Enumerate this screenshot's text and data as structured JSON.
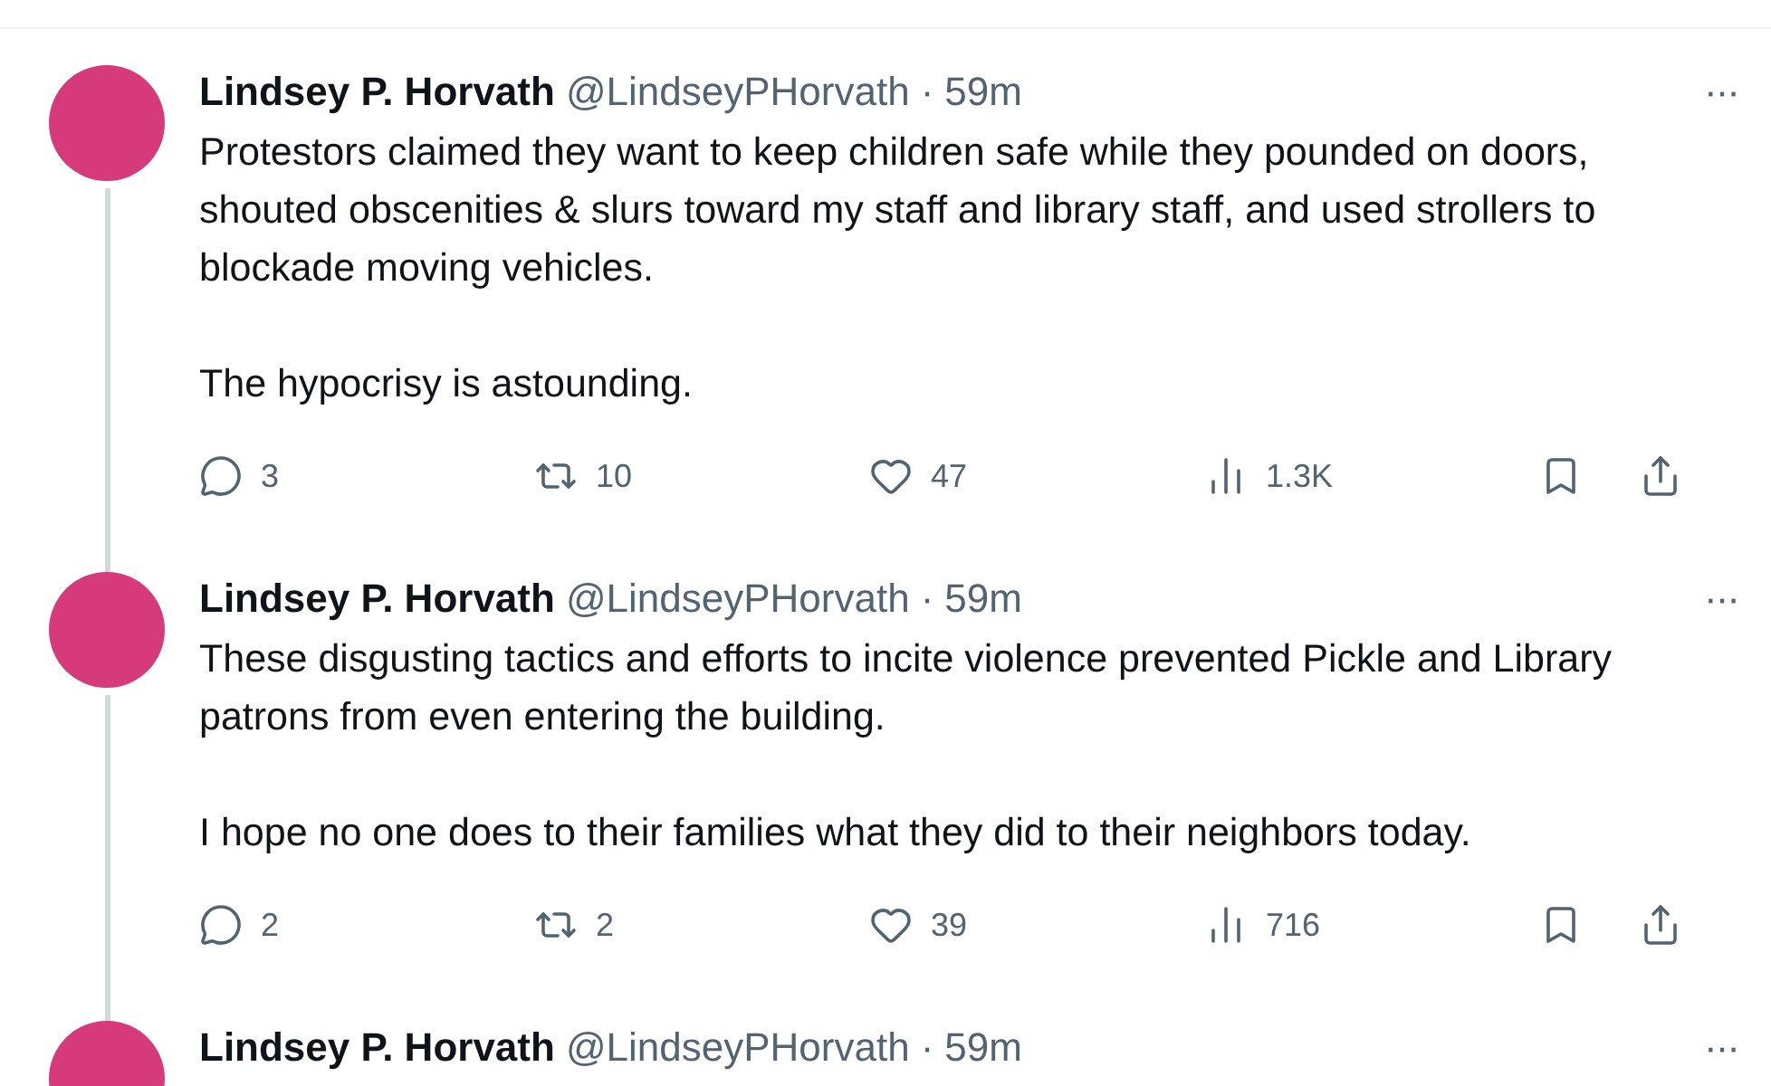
{
  "tweets": [
    {
      "author": "Lindsey P. Horvath",
      "handle": "@LindseyPHorvath",
      "separator": "·",
      "time": "59m",
      "more": "···",
      "paragraphs": [
        "Protestors claimed they want to keep children safe while they pounded on doors, shouted obscenities & slurs toward my staff and library staff, and used strollers to blockade moving vehicles.",
        "The hypocrisy is astounding."
      ],
      "stats": {
        "replies": "3",
        "retweets": "10",
        "likes": "47",
        "views": "1.3K"
      }
    },
    {
      "author": "Lindsey P. Horvath",
      "handle": "@LindseyPHorvath",
      "separator": "·",
      "time": "59m",
      "more": "···",
      "paragraphs": [
        "These disgusting tactics and efforts to incite violence prevented Pickle and Library patrons from even entering the building.",
        "I hope no one does to their families what they did to their neighbors today."
      ],
      "stats": {
        "replies": "2",
        "retweets": "2",
        "likes": "39",
        "views": "716"
      }
    },
    {
      "author": "Lindsey P. Horvath",
      "handle": "@LindseyPHorvath",
      "separator": "·",
      "time": "59m",
      "more": "···"
    }
  ]
}
